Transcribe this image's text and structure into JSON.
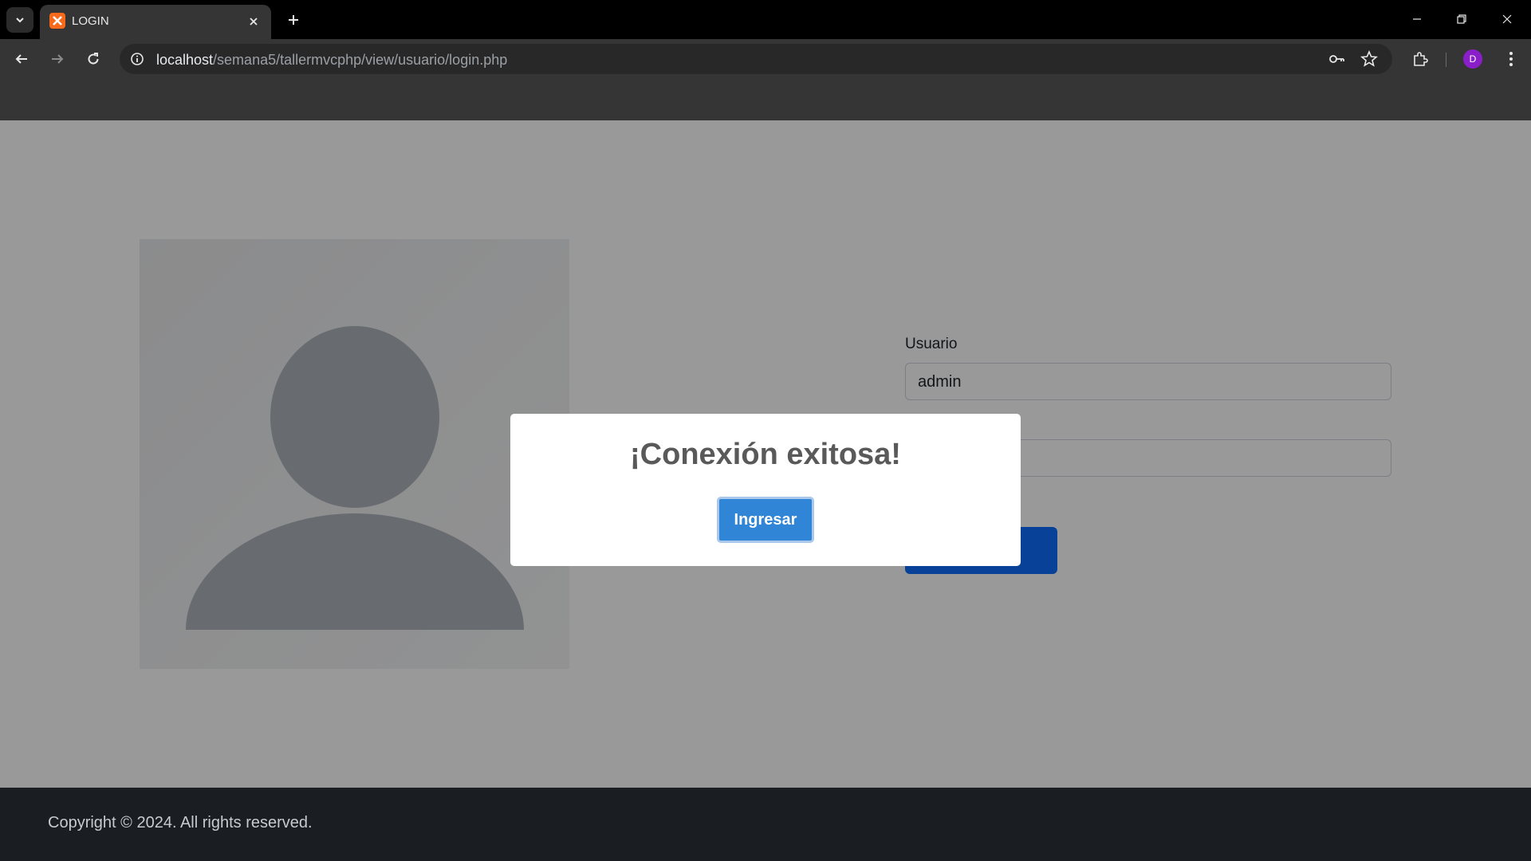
{
  "browser": {
    "tab_title": "LOGIN",
    "url_host": "localhost",
    "url_path": "/semana5/tallermvcphp/view/usuario/login.php",
    "profile_initial": "D",
    "profile_color": "#8a1fc9"
  },
  "form": {
    "usuario_label": "Usuario",
    "usuario_value": "admin"
  },
  "modal": {
    "title": "¡Conexión exitosa!",
    "confirm_label": "Ingresar",
    "confirm_color": "#3085d6"
  },
  "footer": {
    "copyright": "Copyright © 2024. All rights reserved."
  }
}
